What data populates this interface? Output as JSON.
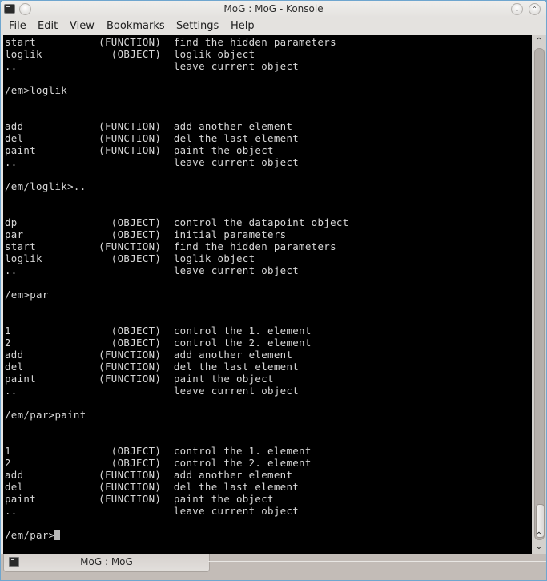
{
  "window": {
    "title": "MoG : MoG - Konsole",
    "buttons": {
      "menu": "",
      "minimize": "⌄",
      "maximize": "⌃"
    }
  },
  "menubar": {
    "items": [
      "File",
      "Edit",
      "View",
      "Bookmarks",
      "Settings",
      "Help"
    ]
  },
  "terminal": {
    "lines": [
      "start          (FUNCTION)  find the hidden parameters",
      "loglik           (OBJECT)  loglik object",
      "..                         leave current object",
      "",
      "/em>loglik",
      "",
      "",
      "add            (FUNCTION)  add another element",
      "del            (FUNCTION)  del the last element",
      "paint          (FUNCTION)  paint the object",
      "..                         leave current object",
      "",
      "/em/loglik>..",
      "",
      "",
      "dp               (OBJECT)  control the datapoint object",
      "par              (OBJECT)  initial parameters",
      "start          (FUNCTION)  find the hidden parameters",
      "loglik           (OBJECT)  loglik object",
      "..                         leave current object",
      "",
      "/em>par",
      "",
      "",
      "1                (OBJECT)  control the 1. element",
      "2                (OBJECT)  control the 2. element",
      "add            (FUNCTION)  add another element",
      "del            (FUNCTION)  del the last element",
      "paint          (FUNCTION)  paint the object",
      "..                         leave current object",
      "",
      "/em/par>paint",
      "",
      "",
      "1                (OBJECT)  control the 1. element",
      "2                (OBJECT)  control the 2. element",
      "add            (FUNCTION)  add another element",
      "del            (FUNCTION)  del the last element",
      "paint          (FUNCTION)  paint the object",
      "..                         leave current object",
      "",
      "/em/par>"
    ],
    "colors": {
      "background": "#000000",
      "foreground": "#d8d8d8"
    }
  },
  "scrollbar": {
    "up_arrow": "⌃",
    "down_arrow": "⌄",
    "position": 1.0
  },
  "tabs": [
    {
      "label": "MoG : MoG",
      "active": true
    }
  ]
}
